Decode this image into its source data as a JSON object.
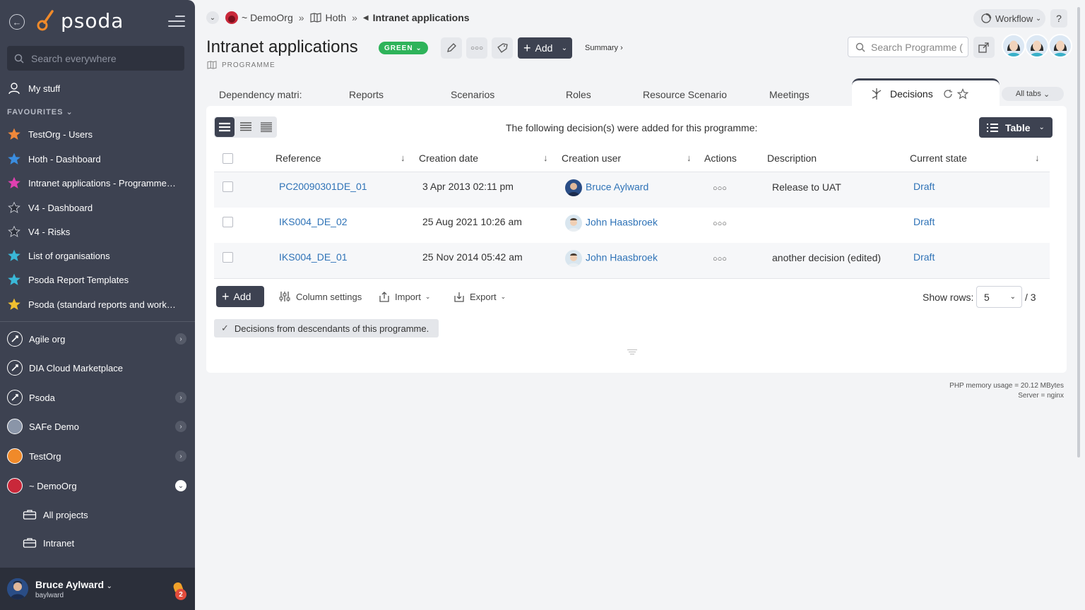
{
  "sidebar": {
    "brand": "psoda",
    "search_placeholder": "Search everywhere",
    "my_stuff": "My stuff",
    "favourites_heading": "FAVOURITES",
    "favourites": [
      {
        "label": "TestOrg - Users",
        "color": "#f0883a"
      },
      {
        "label": "Hoth - Dashboard",
        "color": "#3a8de0"
      },
      {
        "label": "Intranet applications - Programme…",
        "color": "#e040b0"
      },
      {
        "label": "V4 - Dashboard",
        "color": "#2b2f3a"
      },
      {
        "label": "V4 - Risks",
        "color": "#2b2f3a"
      },
      {
        "label": "List of organisations",
        "color": "#3ab8d8"
      },
      {
        "label": "Psoda Report Templates",
        "color": "#3ab8d8"
      },
      {
        "label": "Psoda (standard reports and work…",
        "color": "#f0c030"
      }
    ],
    "orgs": [
      {
        "label": "Agile org",
        "chevron": true
      },
      {
        "label": "DIA Cloud Marketplace",
        "chevron": false
      },
      {
        "label": "Psoda",
        "chevron": true
      },
      {
        "label": "SAFe Demo",
        "chevron": true
      },
      {
        "label": "TestOrg",
        "chevron": true
      },
      {
        "label": "~ DemoOrg",
        "chevron": true
      }
    ],
    "subitems": [
      "All projects",
      "Intranet"
    ],
    "user": {
      "name": "Bruce Aylward",
      "login": "baylward",
      "notifications": "2"
    }
  },
  "breadcrumb": {
    "org": "~ DemoOrg",
    "parent": "Hoth",
    "current": "Intranet applications"
  },
  "page": {
    "title": "Intranet applications",
    "status": "GREEN",
    "type": "PROGRAMME",
    "add_label": "Add",
    "summary_label": "Summary ›",
    "workflow_label": "Workflow",
    "help_label": "?",
    "search_placeholder": "Search Programme (",
    "status_color": "#2eb35a"
  },
  "tabs": [
    {
      "label": "Dependency matri:"
    },
    {
      "label": "Reports"
    },
    {
      "label": "Scenarios"
    },
    {
      "label": "Roles"
    },
    {
      "label": "Resource Scenario:"
    },
    {
      "label": "Meetings"
    }
  ],
  "active_tab": "Decisions",
  "all_tabs": "All tabs",
  "decisions": {
    "intro": "The following decision(s) were added for this programme:",
    "view_label": "Table",
    "columns": [
      "Reference",
      "Creation date",
      "Creation user",
      "Actions",
      "Description",
      "Current state"
    ],
    "rows": [
      {
        "reference": "PC20090301DE_01",
        "date": "3 Apr 2013 02:11 pm",
        "user": "Bruce Aylward",
        "description": "Release to UAT",
        "state": "Draft"
      },
      {
        "reference": "IKS004_DE_02",
        "date": "25 Aug 2021 10:26 am",
        "user": "John Haasbroek",
        "description": "",
        "state": "Draft"
      },
      {
        "reference": "IKS004_DE_01",
        "date": "25 Nov 2014 05:42 am",
        "user": "John Haasbroek",
        "description": "another decision (edited)",
        "state": "Draft"
      }
    ],
    "add_label": "Add",
    "column_settings": "Column settings",
    "import_label": "Import",
    "export_label": "Export",
    "show_rows_label": "Show rows:",
    "show_rows_value": "5",
    "total": "/ 3",
    "descendants_toggle": "Decisions from descendants of this programme."
  },
  "footer": {
    "memory": "PHP memory usage = 20.12 MBytes",
    "server": "Server = nginx"
  }
}
